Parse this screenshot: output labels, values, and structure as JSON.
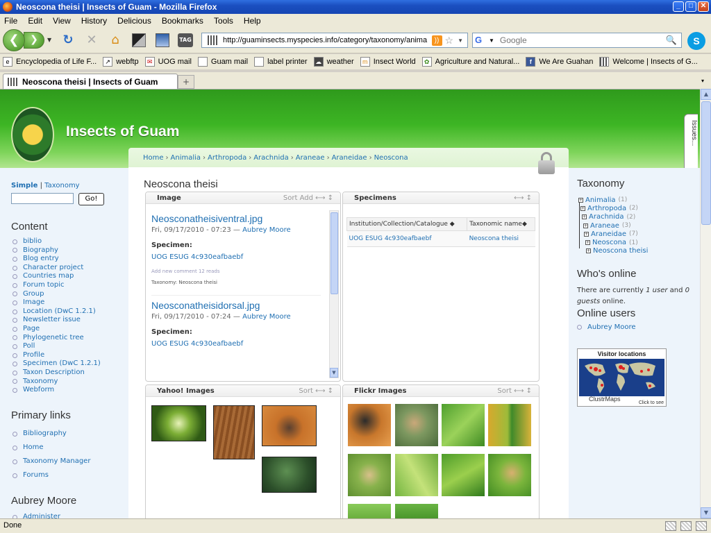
{
  "window": {
    "title": "Neoscona theisi | Insects of Guam - Mozilla Firefox",
    "min": "_",
    "max": "□",
    "close": "✕"
  },
  "menu": [
    "File",
    "Edit",
    "View",
    "History",
    "Delicious",
    "Bookmarks",
    "Tools",
    "Help"
  ],
  "toolbar": {
    "url": "http://guaminsects.myspecies.info/category/taxonomy/anima",
    "search_placeholder": "Google",
    "back": "❮",
    "forward": "❯",
    "reload": "↻",
    "stop": "✕",
    "home": "⌂",
    "tag": "TAG"
  },
  "bookmarks": [
    {
      "label": "Encyclopedia of Life F...",
      "icon": "globe-icon"
    },
    {
      "label": "webftp",
      "icon": "ftp-icon"
    },
    {
      "label": "UOG mail",
      "icon": "mail-icon"
    },
    {
      "label": "Guam mail",
      "icon": "page-icon"
    },
    {
      "label": "label printer",
      "icon": "page-icon"
    },
    {
      "label": "weather",
      "icon": "weather-icon"
    },
    {
      "label": "Insect World",
      "icon": "insect-icon"
    },
    {
      "label": "Agriculture and Natural...",
      "icon": "leaf-icon"
    },
    {
      "label": "We Are Guahan",
      "icon": "facebook-icon"
    },
    {
      "label": "Welcome | Insects of G...",
      "icon": "grid-icon"
    }
  ],
  "tab": {
    "title": "Neoscona theisi | Insects of Guam",
    "new_tab": "+",
    "list": "▾"
  },
  "site": {
    "name": "Insects of Guam",
    "issues_tab": "Issues...",
    "breadcrumb": [
      "Home",
      "Animalia",
      "Arthropoda",
      "Arachnida",
      "Araneae",
      "Araneidae",
      "Neoscona"
    ],
    "breadcrumb_sep": "›"
  },
  "search": {
    "simple": "Simple",
    "sep": "|",
    "taxonomy": "Taxonomy",
    "go": "Go!"
  },
  "content_block": {
    "title": "Content",
    "items": [
      "biblio",
      "Biography",
      "Blog entry",
      "Character project",
      "Countries map",
      "Forum topic",
      "Group",
      "Image",
      "Location (DwC 1.2.1)",
      "Newsletter issue",
      "Page",
      "Phylogenetic tree",
      "Poll",
      "Profile",
      "Specimen (DwC 1.2.1)",
      "Taxon Description",
      "Taxonomy",
      "Webform"
    ]
  },
  "primary_links": {
    "title": "Primary links",
    "items": [
      "Bibliography",
      "Home",
      "Taxonomy Manager",
      "Forums"
    ]
  },
  "user_block": {
    "title": "Aubrey Moore",
    "items": [
      "Administer"
    ]
  },
  "main": {
    "page_title": "Neoscona theisi",
    "image_panel": {
      "title": "Image",
      "tools": "Sort  Add  ⟷  ↕",
      "entries": [
        {
          "title": "Neosconatheisiventral.jpg",
          "date": "Fri, 09/17/2010 - 07:23 — ",
          "author": "Aubrey Moore",
          "specimen_label": "Specimen:",
          "specimen": "UOG ESUG 4c930eafbaebf",
          "links": "Add new comment     12 reads",
          "taxonomy": "Taxonomy: Neoscona theisi"
        },
        {
          "title": "Neosconatheisidorsal.jpg",
          "date": "Fri, 09/17/2010 - 07:24 — ",
          "author": "Aubrey Moore",
          "specimen_label": "Specimen:",
          "specimen": "UOG ESUG 4c930eafbaebf"
        }
      ]
    },
    "specimens_panel": {
      "title": "Specimens",
      "tools": "⟷  ↕",
      "headers": [
        "Institution/Collection/Catalogue ◆",
        "Taxonomic name◆"
      ],
      "rows": [
        [
          "UOG ESUG 4c930eafbaebf",
          "Neoscona theisi"
        ]
      ]
    },
    "yahoo_panel": {
      "title": "Yahoo! Images",
      "tools": "Sort  ⟷  ↕"
    },
    "flickr_panel": {
      "title": "Flickr Images",
      "tools": "Sort  ⟷  ↕"
    }
  },
  "sidebar_right": {
    "taxonomy_title": "Taxonomy",
    "tree": [
      {
        "name": "Animalia",
        "count": "(1)"
      },
      {
        "name": "Arthropoda",
        "count": "(2)"
      },
      {
        "name": "Arachnida",
        "count": "(2)"
      },
      {
        "name": "Araneae",
        "count": "(3)"
      },
      {
        "name": "Araneidae",
        "count": "(7)"
      },
      {
        "name": "Neoscona",
        "count": "(1)"
      },
      {
        "name": "Neoscona theisi",
        "count": ""
      }
    ],
    "whos_online_title": "Who's online",
    "whos_online_text_1": "There are currently ",
    "whos_online_count_users": "1 user",
    "whos_online_text_2": "and ",
    "whos_online_count_guests": "0 guests",
    "whos_online_text_3": " online.",
    "online_users_title": "Online users",
    "online_users": [
      "Aubrey Moore"
    ],
    "map_title": "Visitor locations",
    "map_brand": "ClustrMaps",
    "map_click": "Click to see"
  },
  "status": {
    "text": "Done"
  },
  "colors": {
    "header_green": "#3db524",
    "link_blue": "#1f6fb2",
    "sidebar_bg": "#edf4fb"
  }
}
